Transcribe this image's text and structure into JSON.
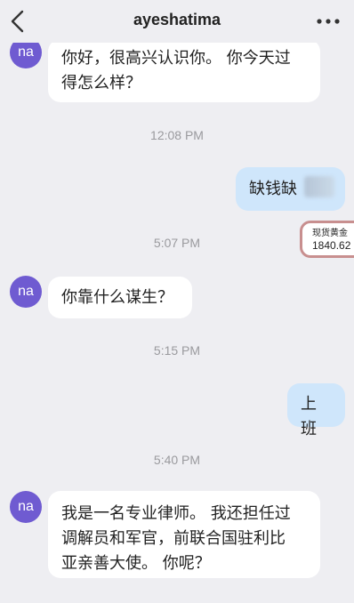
{
  "header": {
    "title": "ayeshatima",
    "back_icon": "chevron-left-icon",
    "more_icon": "more-horizontal-icon"
  },
  "contact": {
    "avatar_initials": "na",
    "avatar_color": "#6f5bd1"
  },
  "messages": [
    {
      "type": "in",
      "text_lines": [
        "你好，很高兴认识你。 你今天过",
        "得怎么样？"
      ]
    },
    {
      "type": "time",
      "text": "12:08 PM"
    },
    {
      "type": "out",
      "text": "缺钱缺"
    },
    {
      "type": "time",
      "text": "5:07 PM"
    },
    {
      "type": "in",
      "text": "你靠什么谋生？"
    },
    {
      "type": "time",
      "text": "5:15 PM"
    },
    {
      "type": "out",
      "text": "上班"
    },
    {
      "type": "time",
      "text": "5:40 PM"
    },
    {
      "type": "in",
      "text_lines": [
        "我是一名专业律师。 我还担任过",
        "调解员和军官，前联合国驻利比",
        "亚亲善大使。 你呢？"
      ]
    }
  ],
  "floating_widget": {
    "label": "现货黄金",
    "value": "1840.62"
  },
  "colors": {
    "background": "#eeeef2",
    "incoming_bubble": "#ffffff",
    "outgoing_bubble": "#cfe6fb",
    "timestamp": "#9a9a9e",
    "widget_border": "#c88f8f"
  }
}
